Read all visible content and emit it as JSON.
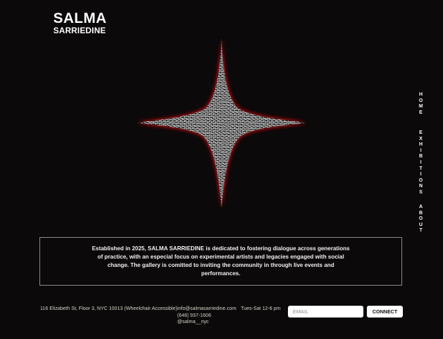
{
  "brand": {
    "name_top": "SALMA",
    "name_bottom": "SARRIEDINE"
  },
  "nav": {
    "items": [
      {
        "label": "HOME"
      },
      {
        "label": "EXHIBITIONS"
      },
      {
        "label": "ABOUT"
      }
    ]
  },
  "hero": {
    "image": "star-icon"
  },
  "intro": {
    "text": "Established in 2025, SALMA SARRIEDINE is dedicated to fostering dialogue across generations of practice, with an especial focus on experimental artists and legacies engaged with social change. The gallery is comitted to inviting the community in through live events and performances."
  },
  "footer": {
    "address": "116 Elizabeth St, Floor 3, NYC 10013 (Wheelchair Accessible)",
    "email": "info@salmasarriedine.com",
    "phone": "(646) 937-1606",
    "handle": "@salma__nyc",
    "hours": "Tues-Sat 12-6 pm"
  },
  "newsletter": {
    "placeholder": "EMAIL",
    "value": "",
    "button_label": "CONNECT"
  },
  "colors": {
    "background": "#0b0909",
    "text": "#ffffff",
    "star_glow": "#b3171f",
    "border": "#8e8a87"
  }
}
